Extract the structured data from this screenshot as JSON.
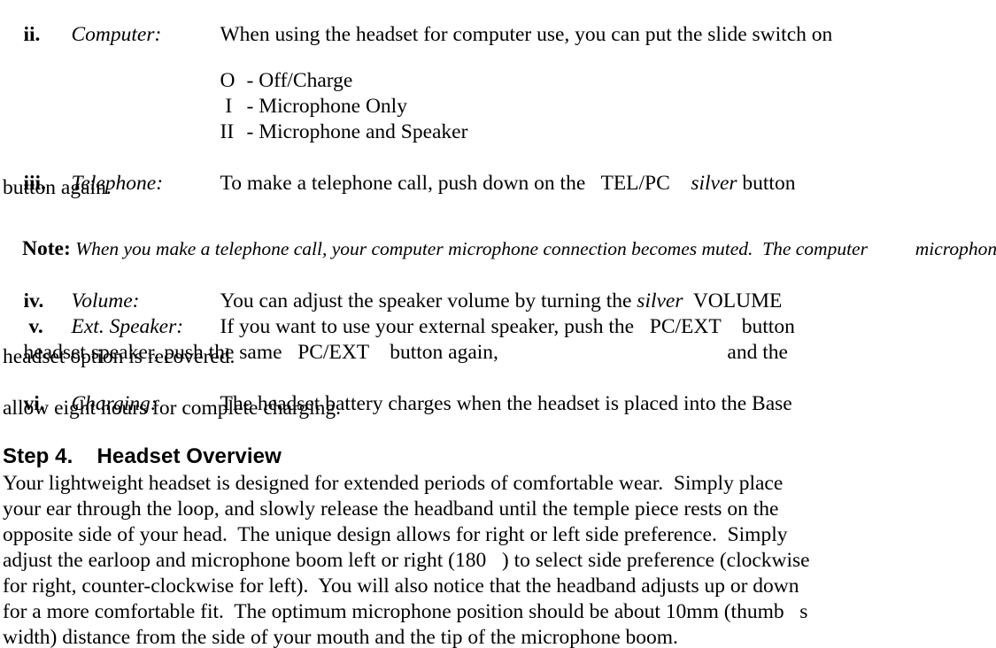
{
  "document": {
    "type": "user-manual-page",
    "background_color": "#ffffff",
    "text_color": "#000000"
  },
  "items": {
    "computer": {
      "numeral": "ii.",
      "term": "Computer:",
      "body": "When using the headset for computer use, you can put the slide switch on"
    },
    "telephone": {
      "numeral": "iii.",
      "term": "Telephone:",
      "body_pre": "To make a telephone call, push down on the   ",
      "body_button": "TEL/PC",
      "body_mid": "    ",
      "body_italic": "silver",
      "body_post": " button",
      "continuation": "button again."
    },
    "volume": {
      "numeral": "iv.",
      "term": "Volume:",
      "body_pre": "You can adjust the speaker volume by turning the ",
      "body_italic": "silver",
      "body_post": "  VOLUME"
    },
    "ext_speaker": {
      "numeral": " v.",
      "term": "Ext. Speaker:",
      "body_pre": "If you want to use your external speaker, push the   ",
      "body_button": "PC/EXT",
      "body_post": "    button",
      "continuation_1_pre": "headset speaker, push the same   ",
      "continuation_1_button": "PC/EXT",
      "continuation_1_post": "    button again,                                            and the",
      "continuation_2": "headset option is recovered."
    },
    "charging": {
      "numeral": "vi.",
      "term": "Charging:",
      "body": "The headset battery charges when the headset is placed into the Base",
      "continuation": "allow eight hours for complete charging."
    }
  },
  "switch_positions": [
    {
      "symbol": "O",
      "separator": "- ",
      "label": "Off/Charge"
    },
    {
      "symbol": " I",
      "separator": "- ",
      "label": "Microphone Only"
    },
    {
      "symbol": "II",
      "separator": "- ",
      "label": "Microphone and Speaker"
    }
  ],
  "note": {
    "label": "Note:",
    "text": " When you make a telephone call, your computer microphone connection becomes muted.  The computer          microphone is rec"
  },
  "section": {
    "step_label": "Step 4.",
    "step_title": "Headset Overview",
    "heading_full": "Step 4.    Headset Overview",
    "paragraph_lines": [
      "Your lightweight headset is designed for extended periods of comfortable wear.  Simply place",
      "your ear through the loop, and slowly release the headband until the temple piece rests on the",
      "opposite side of your head.  The unique design allows for right or left side preference.  Simply",
      "adjust the earloop and microphone boom left or right (180   ) to select side preference (clockwise",
      "for right, counter-clockwise for left).  You will also notice that the headband adjusts up or down",
      "for a more comfortable fit.  The optimum microphone position should be about 10mm (thumb   s",
      "width) distance from the side of your mouth and the tip of the microphone boom."
    ]
  }
}
